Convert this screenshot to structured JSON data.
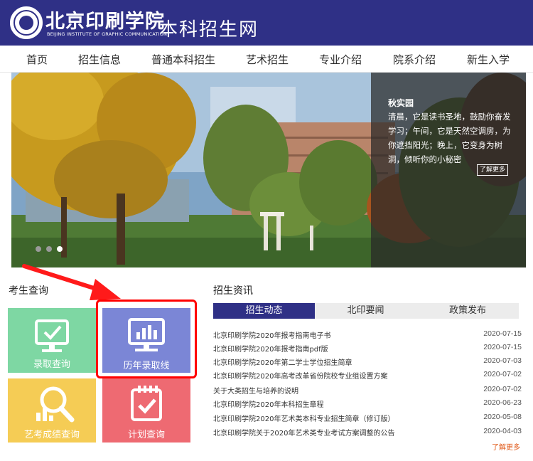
{
  "header": {
    "logo_cn": "北京印刷学院",
    "logo_en": "BEIJING INSTITUTE OF GRAPHIC COMMUNICATION",
    "site_title": "本科招生网",
    "bg_color": "#2f3086"
  },
  "nav": {
    "items": [
      {
        "label": "首页"
      },
      {
        "label": "招生信息"
      },
      {
        "label": "普通本科招生"
      },
      {
        "label": "艺术招生"
      },
      {
        "label": "专业介绍"
      },
      {
        "label": "院系介绍"
      },
      {
        "label": "新生入学"
      }
    ]
  },
  "banner": {
    "caption_title": "秋实园",
    "caption_body": "清晨，它是读书圣地，鼓励你奋发学习；午间，它是天然空调房，为你遮挡阳光；晚上，它变身为树洞，倾听你的小秘密",
    "more_label": "了解更多",
    "slide_count": 3
  },
  "query": {
    "title": "考生查询",
    "tiles": [
      {
        "label": "录取查询",
        "icon": "monitor-check-icon",
        "color": "#7ed7a3"
      },
      {
        "label": "历年录取线",
        "icon": "bar-chart-monitor-icon",
        "color": "#7b86d6"
      },
      {
        "label": "艺考成绩查询",
        "icon": "magnifier-chart-icon",
        "color": "#f5cc55"
      },
      {
        "label": "计划查询",
        "icon": "calendar-check-icon",
        "color": "#ee6a72"
      }
    ]
  },
  "news": {
    "title": "招生资讯",
    "tabs": [
      {
        "label": "招生动态",
        "active": true
      },
      {
        "label": "北印要闻",
        "active": false
      },
      {
        "label": "政策发布",
        "active": false
      }
    ],
    "items": [
      {
        "title": "北京印刷学院2020年报考指南电子书",
        "date": "2020-07-15"
      },
      {
        "title": "北京印刷学院2020年报考指南pdf版",
        "date": "2020-07-15"
      },
      {
        "title": "北京印刷学院2020年第二学士学位招生简章",
        "date": "2020-07-03"
      },
      {
        "title": "北京印刷学院2020年高考改革省份院校专业组设置方案",
        "date": "2020-07-02"
      },
      {
        "title": "关于大类招生与培养的说明",
        "date": "2020-07-02"
      },
      {
        "title": "北京印刷学院2020年本科招生章程",
        "date": "2020-06-23"
      },
      {
        "title": "北京印刷学院2020年艺术类本科专业招生简章（修订版）",
        "date": "2020-05-08"
      },
      {
        "title": "北京印刷学院关于2020年艺术类专业考试方案调整的公告",
        "date": "2020-04-03"
      }
    ],
    "more_label": "了解更多",
    "more_color": "#e05a1a"
  }
}
